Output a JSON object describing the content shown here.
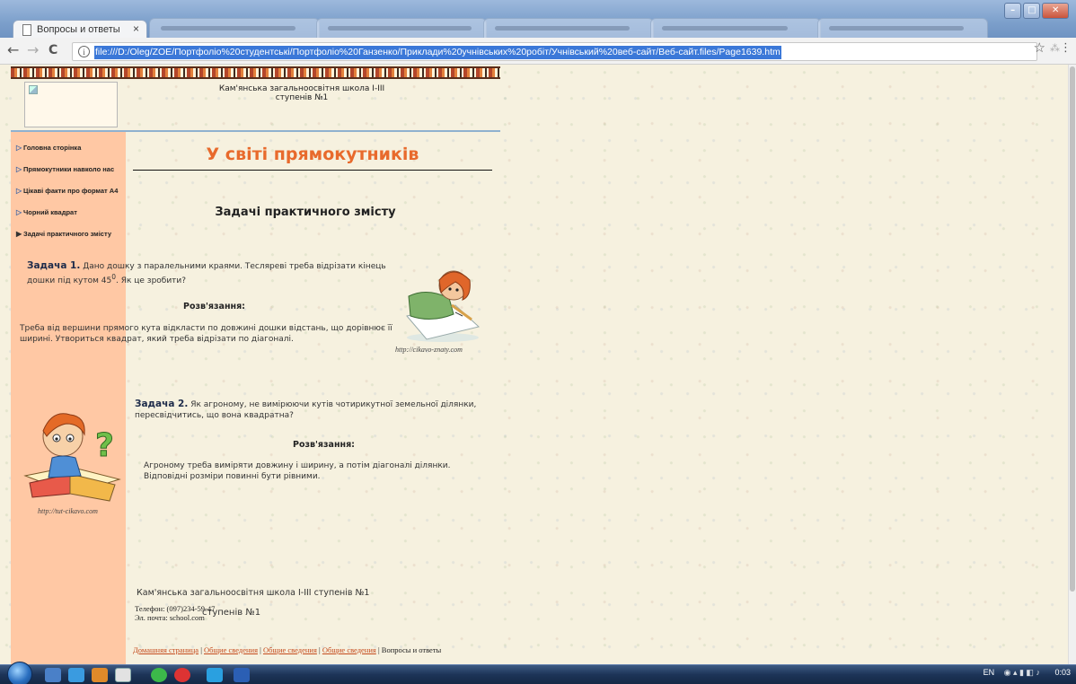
{
  "browser": {
    "tab_title": "Вопросы и ответы",
    "tab_close": "×",
    "url": "file:///D:/Oleg/ZOE/Портфоліо%20студентські/Портфоліо%20Ганзенко/Приклади%20учнівських%20робіт/Учнівський%20веб-сайт/Веб-сайт.files/Page1639.htm",
    "back_glyph": "←",
    "forward_glyph": "→",
    "reload_glyph": "C",
    "info_glyph": "i",
    "star_glyph": "☆",
    "menu_glyph": "⋮"
  },
  "window_controls": {
    "minimize": "–",
    "maximize": "□",
    "close": "✕"
  },
  "header": {
    "school_line1": "Кам'янська загальноосвітня школа І-ІІІ",
    "school_line2": "ступенів №1"
  },
  "sidebar": {
    "items": [
      {
        "label": "Головна сторінка",
        "bullet": "▷"
      },
      {
        "label": "Прямокутники навколо нас",
        "bullet": "▷"
      },
      {
        "label": "Цікаві факти про формат А4",
        "bullet": "▷"
      },
      {
        "label": "Чорний квадрат",
        "bullet": "▷"
      },
      {
        "label": "Задачі практичного змісту",
        "bullet": "▶"
      }
    ]
  },
  "main": {
    "page_title": "У світі прямокутників",
    "section_title": "Задачі практичного змісту",
    "task1": {
      "label": "Задача 1.",
      "text": " Дано дошку з паралельними краями. Тесляреві треба відрізати кінець дошки під кутом 45",
      "superscript": "0",
      "text_end": ". Як це зробити?",
      "solution_head": "Розв'язання:",
      "solution": "Треба від вершини прямого кута відкласти по довжині дошки відстань, що дорівнює її ширині. Утвориться квадрат, який треба відрізати по діагоналі."
    },
    "task2": {
      "label": "Задача 2.",
      "text": " Як агроному, не вимірюючи кутів чотирикутної земельної ділянки, пересвідчитись, що вона квадратна?",
      "solution_head": "Розв'язання:",
      "solution": "Агроному треба виміряти довжину і ширину, а потім діагоналі ділянки. Відповідні розміри повинні бути рівними."
    },
    "image1_source": "http://cikavo-znaty.com",
    "image2_source": "http://tut-cikavo.com"
  },
  "footer": {
    "school": "Кам'янська загальноосвітня школа І-ІІІ ступенів №1",
    "phone": "Телефон: (097)234-59-47",
    "email": "Эл. почта: school.com",
    "overlap_text": "ступенів №1",
    "links": [
      "Домашняя страница",
      "Общие сведения",
      "Общие сведения",
      "Общие сведения"
    ],
    "separator": " | ",
    "current": "Вопросы и ответы"
  },
  "taskbar": {
    "lang": "EN",
    "time": "0:03"
  },
  "colors": {
    "title_orange": "#e86a2c",
    "sidebar_bg": "#ffc8a4",
    "page_bg": "#f6f1df",
    "link_color": "#c44a1c"
  }
}
